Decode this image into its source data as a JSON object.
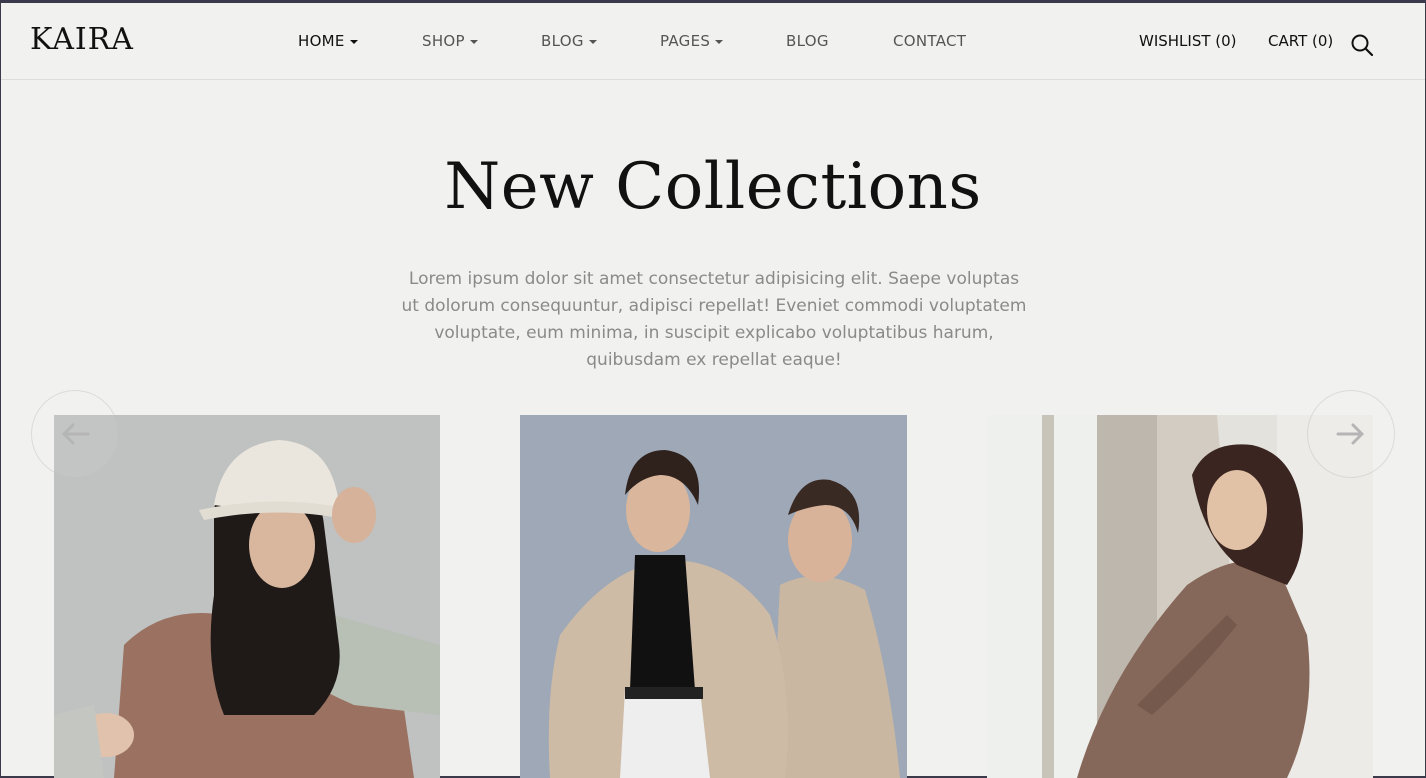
{
  "brand": {
    "logo": "KAIRA"
  },
  "nav": {
    "items": [
      {
        "label": "HOME",
        "dropdown": true,
        "active": true
      },
      {
        "label": "SHOP",
        "dropdown": true
      },
      {
        "label": "BLOG",
        "dropdown": true
      },
      {
        "label": "PAGES",
        "dropdown": true
      },
      {
        "label": "BLOG",
        "dropdown": false
      },
      {
        "label": "CONTACT",
        "dropdown": false
      }
    ]
  },
  "header_right": {
    "wishlist": "WISHLIST (0)",
    "cart": "CART (0)",
    "search_icon": "search-icon"
  },
  "hero": {
    "title": "New Collections",
    "description": "Lorem ipsum dolor sit amet consectetur adipisicing elit. Saepe voluptas ut dolorum consequuntur, adipisci repellat! Eveniet commodi voluptatem voluptate, eum minima, in suscipit explicabo voluptatibus harum, quibusdam ex repellat eaque!"
  },
  "carousel": {
    "prev_icon": "arrow-left-icon",
    "next_icon": "arrow-right-icon",
    "products": [
      {
        "image": "woman-white-bucket-hat-brown-top-photo"
      },
      {
        "image": "two-women-beige-trench-coats-photo"
      },
      {
        "image": "woman-plaid-blazer-leaning-wall-photo"
      }
    ]
  },
  "colors": {
    "background": "#f1f1ef",
    "text_dark": "#111111",
    "text_muted": "#8a8a8a",
    "topbar": "#3b3a4c"
  }
}
